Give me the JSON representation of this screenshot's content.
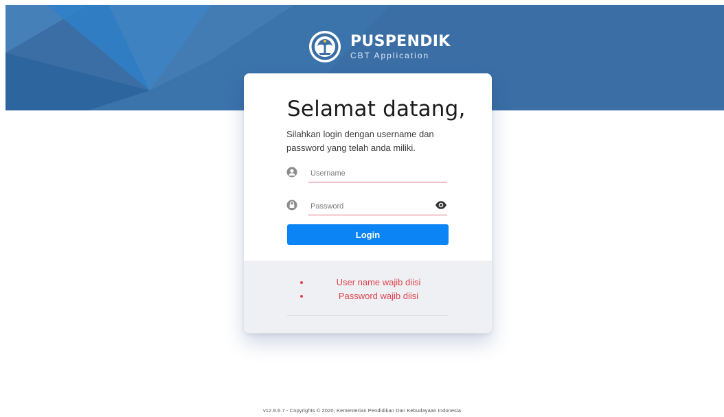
{
  "brand": {
    "title": "PUSPENDIK",
    "subtitle": "CBT Application",
    "emblem_icon": "tut-wuri-handayani-emblem-icon"
  },
  "colors": {
    "banner": "#3a6ea5",
    "primary_button": "#0b84f5",
    "error": "#e0424d",
    "card_footer": "#eef0f3"
  },
  "login": {
    "heading": "Selamat datang,",
    "intro": "Silahkan login dengan username dan password yang telah anda miliki.",
    "username": {
      "placeholder": "Username",
      "value": "",
      "icon": "user-icon"
    },
    "password": {
      "placeholder": "Password",
      "value": "",
      "icon": "lock-icon",
      "toggle_icon": "eye-icon"
    },
    "button_label": "Login"
  },
  "errors": [
    "User name wajib diisi",
    "Password wajib diisi"
  ],
  "footer": {
    "text": "v12.9.6.7 - Copyrights © 2020, Kementerian Pendidikan Dan Kebudayaan Indonesia"
  }
}
